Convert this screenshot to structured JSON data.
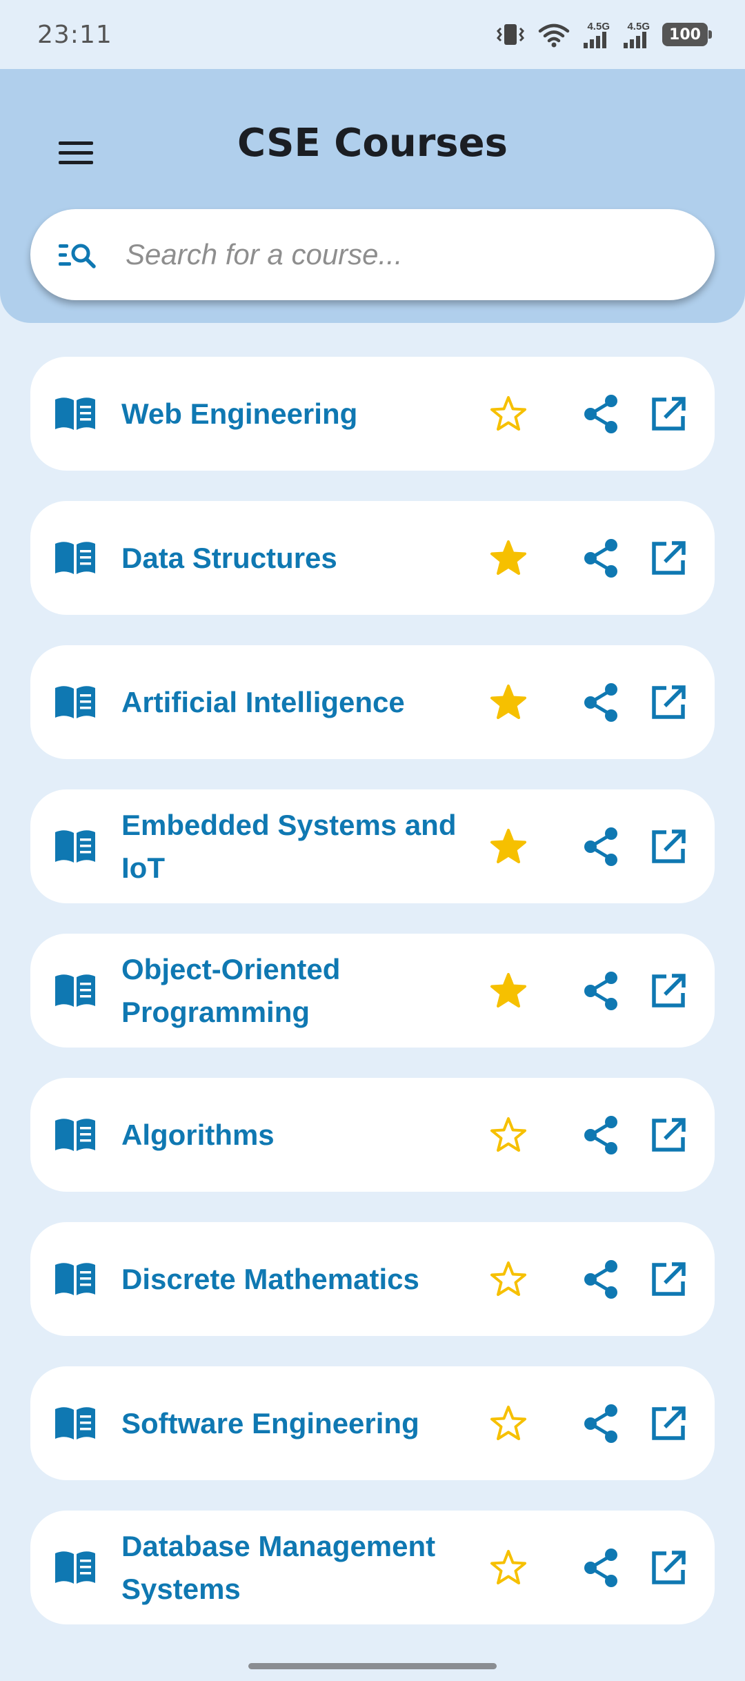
{
  "status_bar": {
    "time": "23:11",
    "network_1": "4.5G",
    "network_2": "4.5G",
    "battery": "100",
    "icons": [
      "vibrate-icon",
      "wifi-icon",
      "signal-icon",
      "signal-icon",
      "battery-icon"
    ]
  },
  "header": {
    "title": "CSE Courses",
    "menu_icon": "menu-icon"
  },
  "search": {
    "placeholder": "Search for a course...",
    "value": "",
    "icon": "search-list-icon"
  },
  "colors": {
    "background": "#e3eef9",
    "header": "#b0cfec",
    "accent_blue": "#0f78b2",
    "star_yellow": "#f6c000",
    "card": "#ffffff"
  },
  "courses": [
    {
      "title": "Web Engineering",
      "favorite": false
    },
    {
      "title": "Data Structures",
      "favorite": true
    },
    {
      "title": "Artificial Intelligence",
      "favorite": true
    },
    {
      "title": "Embedded Systems and IoT",
      "favorite": true
    },
    {
      "title": "Object-Oriented Programming",
      "favorite": true
    },
    {
      "title": "Algorithms",
      "favorite": false
    },
    {
      "title": "Discrete Mathematics",
      "favorite": false
    },
    {
      "title": "Software Engineering",
      "favorite": false
    },
    {
      "title": "Database Management Systems",
      "favorite": false
    }
  ],
  "course_item_icons": {
    "leading": "book-icon",
    "favorite": "star-icon",
    "share": "share-icon",
    "open": "open-external-icon"
  }
}
